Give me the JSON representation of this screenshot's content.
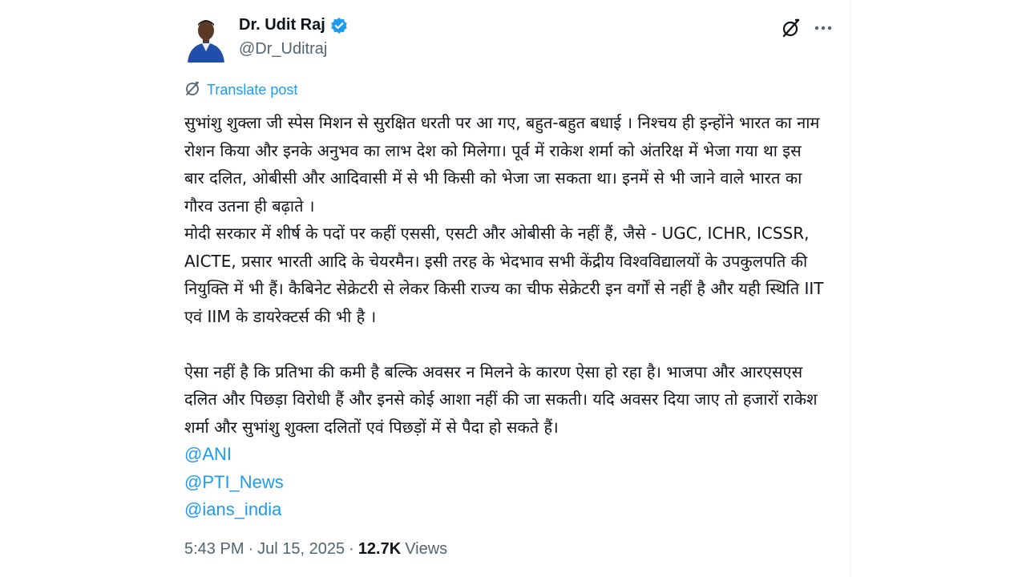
{
  "author": {
    "name": "Dr. Udit Raj",
    "handle": "@Dr_Uditraj",
    "verified": true
  },
  "colors": {
    "accent": "#1d9bf0",
    "text_primary": "#0f1419",
    "text_secondary": "#536471"
  },
  "icons": {
    "grok": "grok-icon",
    "more": "more-icon",
    "translate": "translate-icon",
    "verified": "verified-badge-icon"
  },
  "translate": {
    "label": "Translate post"
  },
  "post": {
    "paragraph1": "सुभांशु शुक्ला जी स्पेस मिशन से सुरक्षित धरती पर आ  गए, बहुत-बहुत  बधाई । निश्चय ही इन्होंने भारत का नाम रोशन किया और इनके अनुभव का लाभ देश को मिलेगा। पूर्व में राकेश शर्मा को अंतरिक्ष में भेजा गया था इस बार दलित, ओबीसी और आदिवासी में से भी किसी को भेजा जा सकता था। इनमें से भी जाने वाले भारत का गौरव उतना ही बढ़ाते ।",
    "paragraph2": "मोदी सरकार में शीर्ष के पदों पर कहीं एससी, एसटी और ओबीसी के नहीं हैं, जैसे - UGC, ICHR, ICSSR, AICTE, प्रसार भारती आदि के चेयरमैन। इसी तरह के भेदभाव सभी केंद्रीय विश्वविद्यालयों के उपकुलपति की नियुक्ति में भी हैं। कैबिनेट सेक्रेटरी से लेकर किसी राज्य का चीफ सेक्रेटरी इन वर्गों से नहीं है और यही स्थिति  IIT एवं IIM के डायरेक्टर्स की भी है ।",
    "paragraph3": "ऐसा नहीं है कि प्रतिभा की कमी है बल्कि अवसर न मिलने के कारण ऐसा हो रहा है। भाजपा और आरएसएस दलित और पिछड़ा विरोधी हैं और इनसे कोई आशा नहीं की जा सकती। यदि अवसर दिया जाए तो हजारों राकेश शर्मा और सुभांशु शुक्ला दलितों एवं पिछड़ों में से पैदा हो सकते हैं।",
    "mentions": [
      "@ANI",
      "@PTI_News",
      "@ians_india"
    ]
  },
  "meta": {
    "time": "5:43 PM",
    "separator": "·",
    "date": "Jul 15, 2025",
    "views_count": "12.7K",
    "views_label": "Views"
  }
}
